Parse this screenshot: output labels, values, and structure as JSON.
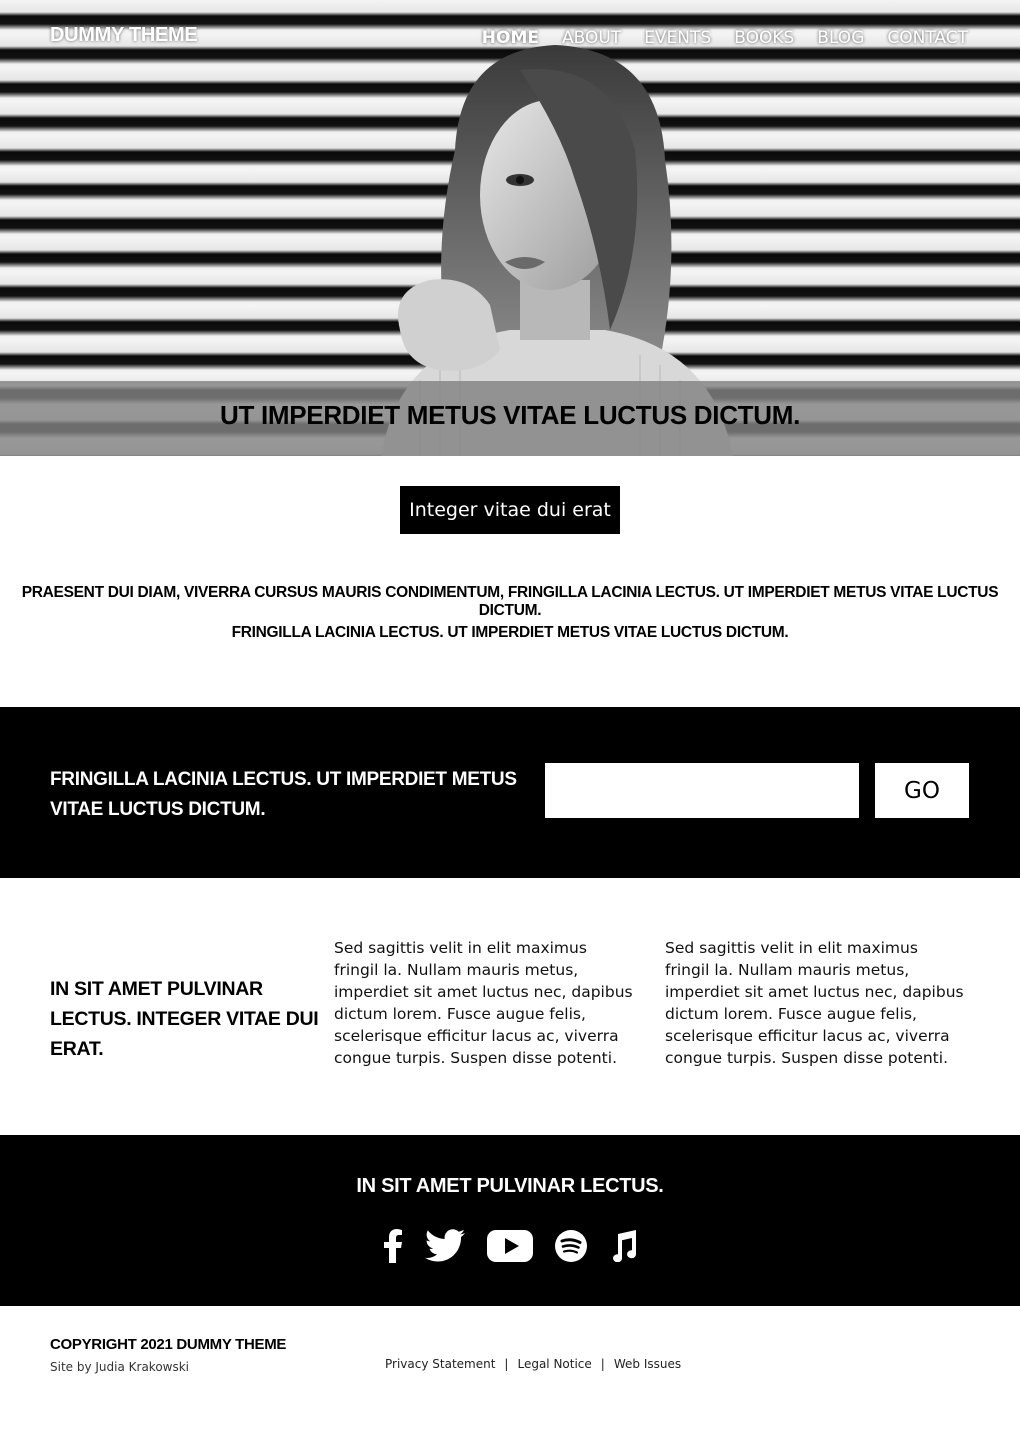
{
  "header": {
    "logo": "DUMMY THEME",
    "nav": [
      {
        "label": "HOME",
        "active": true
      },
      {
        "label": "ABOUT"
      },
      {
        "label": "EVENTS"
      },
      {
        "label": "BOOKS"
      },
      {
        "label": "BLOG"
      },
      {
        "label": "CONTACT"
      }
    ]
  },
  "hero": {
    "title": "UT IMPERDIET METUS VITAE LUCTUS DICTUM."
  },
  "cta": {
    "label": "Integer vitae dui erat"
  },
  "intro": {
    "line1": "PRAESENT DUI DIAM, VIVERRA CURSUS MAURIS CONDIMENTUM, FRINGILLA LACINIA LECTUS. UT IMPERDIET METUS VITAE LUCTUS DICTUM.",
    "line2": "FRINGILLA LACINIA LECTUS. UT IMPERDIET METUS VITAE LUCTUS DICTUM."
  },
  "newsletter": {
    "text": "FRINGILLA LACINIA LECTUS. UT IMPERDIET METUS VITAE LUCTUS DICTUM.",
    "input_value": "",
    "button_label": "GO"
  },
  "columns": {
    "heading": "IN SIT AMET PULVINAR LECTUS. INTEGER VITAE DUI ERAT.",
    "text_a": "Sed sagittis velit in elit maximus fringil la. Nullam mauris metus, imperdiet sit amet luctus nec, dapibus dictum lorem. Fusce augue felis, scelerisque efficitur lacus ac, viverra congue turpis. Suspen disse potenti.",
    "text_b": "Sed sagittis velit in elit maximus fringil la. Nullam mauris metus, imperdiet sit amet luctus nec, dapibus dictum lorem. Fusce augue felis, scelerisque efficitur lacus ac, viverra congue turpis. Suspen disse potenti."
  },
  "social": {
    "title": "IN SIT AMET PULVINAR LECTUS.",
    "icons": [
      "facebook-icon",
      "twitter-icon",
      "youtube-icon",
      "spotify-icon",
      "music-note-icon"
    ]
  },
  "footer": {
    "copyright": "COPYRIGHT 2021 DUMMY THEME",
    "credit": "Site by Judia Krakowski",
    "links": [
      "Privacy Statement",
      "Legal Notice",
      "Web Issues"
    ],
    "separator": "|"
  },
  "colors": {
    "background": "#ffffff",
    "dark": "#000000",
    "band_gray": "#828282"
  }
}
